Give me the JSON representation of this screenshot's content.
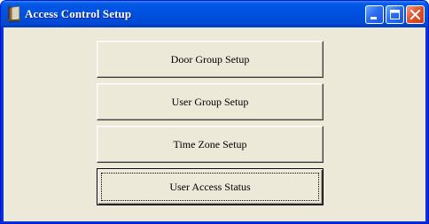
{
  "window": {
    "title": "Access Control Setup",
    "icon": "door-icon"
  },
  "title_buttons": {
    "minimize": "minimize-icon",
    "maximize": "maximize-icon",
    "close": "close-icon"
  },
  "buttons": [
    {
      "label": "Door Group Setup"
    },
    {
      "label": "User Group Setup"
    },
    {
      "label": "Time Zone Setup"
    },
    {
      "label": "User Access Status",
      "focused": true
    }
  ],
  "colors": {
    "titlebar": "#0055e5",
    "client_background": "#ece9d8",
    "close_button": "#e0562e"
  }
}
